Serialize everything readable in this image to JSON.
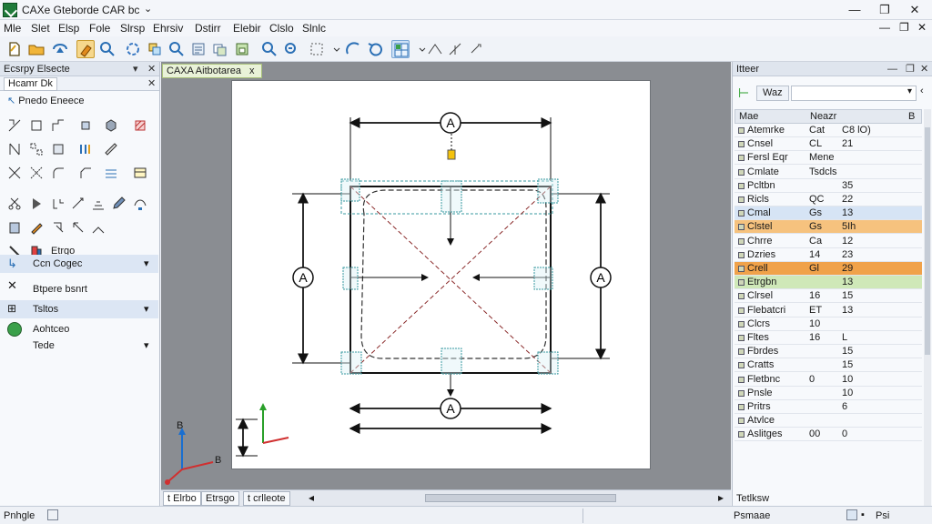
{
  "app": {
    "title": "CAXe Gteborde CAR bc"
  },
  "window_controls": {
    "minimize": "—",
    "maximize": "❐",
    "close": "✕"
  },
  "menu": [
    "Mle",
    "Slet",
    "Elsp",
    "Fole",
    "Slrsp",
    "Ehrsiv",
    "Dstirr",
    "Elebir",
    "Clslo",
    "Slnlc"
  ],
  "left_panel": {
    "title": "Ecsrpy Elsecte",
    "subtab": "Hcamr Dk",
    "section_label": "Pnedo Eneece",
    "misc_label": "Etrgo",
    "rows": [
      {
        "label": "Ccn Cogec",
        "has_dropdown": true
      },
      {
        "label": "Btpere bsnrt",
        "has_dropdown": false
      },
      {
        "label": "Tsltos",
        "has_dropdown": true
      },
      {
        "label": "Aohtceo",
        "has_dropdown": false
      },
      {
        "label": "Tede",
        "has_dropdown": true
      }
    ]
  },
  "canvas": {
    "tab_label": "CAXA Aitbotarea",
    "tab_close": "x",
    "dimension_letter": "A",
    "axis_labels": {
      "z": "B",
      "x": "B"
    }
  },
  "bottom_tabs": [
    "t Elrbo",
    "Etrsgo",
    "t crlleote"
  ],
  "right_panel": {
    "title": "Itteer",
    "search_value": "Waz",
    "columns": [
      "Mae",
      "Neazr",
      "B"
    ],
    "rows": [
      {
        "name": "Atemrke",
        "v1": "Cat",
        "v2": "C8 lO)",
        "highlight": ""
      },
      {
        "name": "Cnsel",
        "v1": "CL",
        "v2": "21",
        "highlight": ""
      },
      {
        "name": "Fersl Eqr",
        "v1": "Mene",
        "v2": "",
        "highlight": ""
      },
      {
        "name": "Cmlate",
        "v1": "Tsdcls",
        "v2": "",
        "highlight": ""
      },
      {
        "name": "Pcltbn",
        "v1": "",
        "v2": "35",
        "highlight": ""
      },
      {
        "name": "Ricls",
        "v1": "QC",
        "v2": "22",
        "highlight": ""
      },
      {
        "name": "Cmal",
        "v1": "Gs",
        "v2": "13",
        "highlight": "blue"
      },
      {
        "name": "Clstel",
        "v1": "Gs",
        "v2": "5Ih",
        "highlight": "orange-light"
      },
      {
        "name": "Chrre",
        "v1": "Ca",
        "v2": "12",
        "highlight": ""
      },
      {
        "name": "Dzries",
        "v1": "14",
        "v2": "23",
        "highlight": ""
      },
      {
        "name": "Crell",
        "v1": "Gl",
        "v2": "29",
        "highlight": "orange"
      },
      {
        "name": "Etrgbn",
        "v1": "",
        "v2": "13",
        "highlight": "green"
      },
      {
        "name": "Clrsel",
        "v1": "16",
        "v2": "15",
        "highlight": ""
      },
      {
        "name": "Flebatcri",
        "v1": "ET",
        "v2": "13",
        "highlight": ""
      },
      {
        "name": "Clcrs",
        "v1": "10",
        "v2": "",
        "highlight": ""
      },
      {
        "name": "Fltes",
        "v1": "16",
        "v2": "L",
        "highlight": ""
      },
      {
        "name": "Fbrdes",
        "v1": "",
        "v2": "15",
        "highlight": ""
      },
      {
        "name": "Cratts",
        "v1": "",
        "v2": "15",
        "highlight": ""
      },
      {
        "name": "Fletbnc",
        "v1": "0",
        "v2": "10",
        "highlight": ""
      },
      {
        "name": "Pnsle",
        "v1": "",
        "v2": "10",
        "highlight": ""
      },
      {
        "name": "Pritrs",
        "v1": "",
        "v2": "6",
        "highlight": ""
      },
      {
        "name": "Atvlce",
        "v1": "",
        "v2": "",
        "highlight": ""
      },
      {
        "name": "Aslitges",
        "v1": "00",
        "v2": "0",
        "highlight": ""
      }
    ],
    "footer_label": "Tetlksw"
  },
  "statusbar": {
    "left": "Pnhgle",
    "right_left": "Psmaae",
    "right_right": "Psi"
  },
  "colors": {
    "accent_green": "#1f7a3a",
    "highlight_blue": "#d6e4f5",
    "highlight_orange": "#f0a24a",
    "highlight_orange_light": "#f6c27e",
    "highlight_green": "#cfe8b8"
  }
}
